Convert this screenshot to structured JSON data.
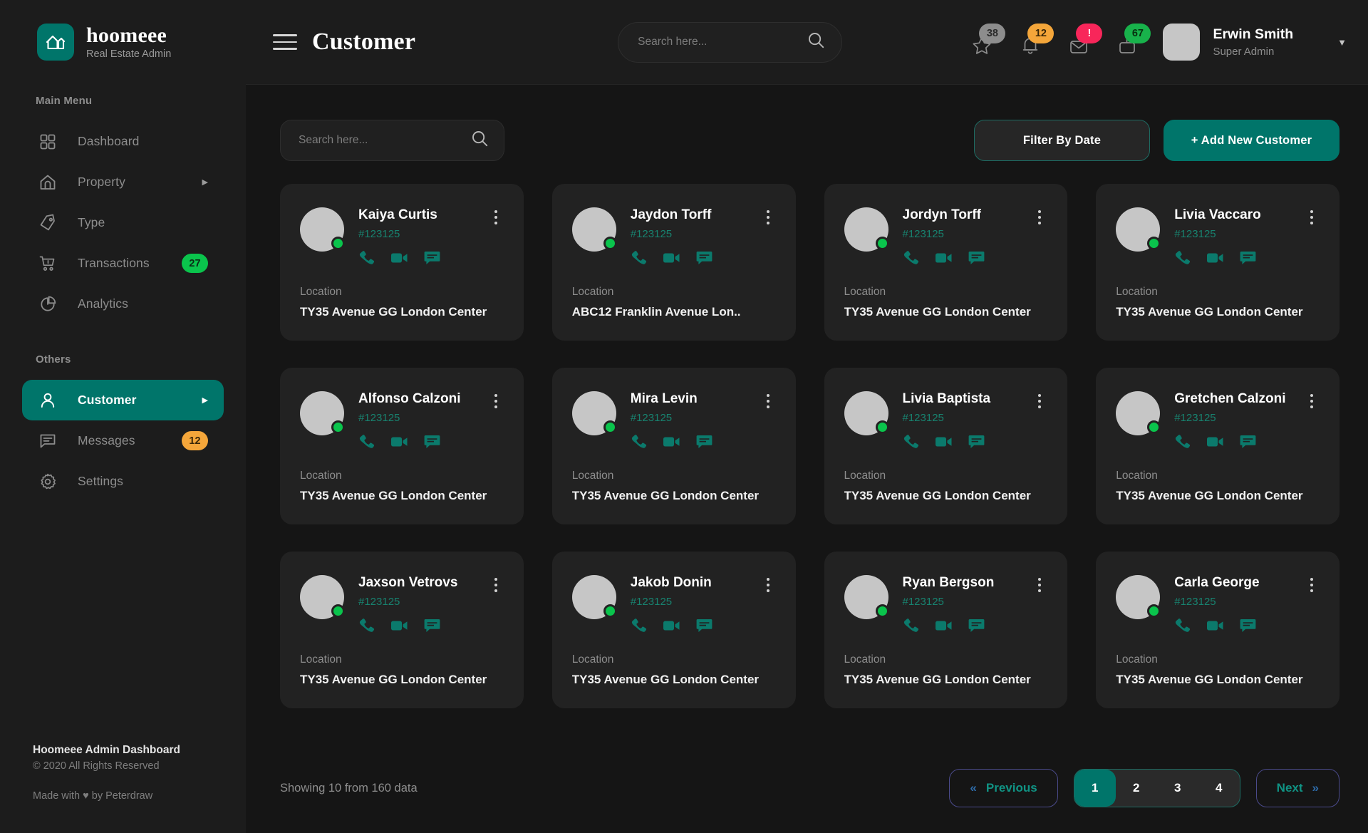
{
  "brand": {
    "name": "hoomeee",
    "subtitle": "Real Estate Admin",
    "logo_icon": "house-icon",
    "logo_color": "#00756a"
  },
  "sidebar": {
    "main_label": "Main Menu",
    "others_label": "Others",
    "main_items": [
      {
        "label": "Dashboard",
        "icon": "grid-icon",
        "badge": null,
        "arrow": false,
        "active": false
      },
      {
        "label": "Property",
        "icon": "home-icon",
        "badge": null,
        "arrow": true,
        "active": false
      },
      {
        "label": "Type",
        "icon": "tag-icon",
        "badge": null,
        "arrow": false,
        "active": false
      },
      {
        "label": "Transactions",
        "icon": "cart-icon",
        "badge": "27",
        "badge_color": "green",
        "arrow": false,
        "active": false
      },
      {
        "label": "Analytics",
        "icon": "pie-chart-icon",
        "badge": null,
        "arrow": false,
        "active": false
      }
    ],
    "other_items": [
      {
        "label": "Customer",
        "icon": "user-icon",
        "badge": null,
        "arrow": true,
        "active": true
      },
      {
        "label": "Messages",
        "icon": "message-icon",
        "badge": "12",
        "badge_color": "orange",
        "arrow": false,
        "active": false
      },
      {
        "label": "Settings",
        "icon": "gear-icon",
        "badge": null,
        "arrow": false,
        "active": false
      }
    ],
    "footer": {
      "title": "Hoomeee Admin Dashboard",
      "copyright": "© 2020 All Rights Reserved",
      "made_by": "Made with ♥ by Peterdraw"
    }
  },
  "topbar": {
    "menu_icon": "hamburger-icon",
    "title": "Customer",
    "search": {
      "placeholder": "Search here...",
      "value": "",
      "icon": "search-icon"
    },
    "icons": [
      {
        "name": "star-icon",
        "badge": "38",
        "badge_color": "#8d8d8d"
      },
      {
        "name": "bell-icon",
        "badge": "12",
        "badge_color": "#f4a63a"
      },
      {
        "name": "mail-icon",
        "badge": "!",
        "badge_color": "#f8265a"
      },
      {
        "name": "archive-icon",
        "badge": "67",
        "badge_color": "#18b24b"
      }
    ],
    "profile": {
      "name": "Erwin Smith",
      "role": "Super Admin",
      "caret_icon": "chevron-down-icon"
    }
  },
  "toolbar": {
    "search": {
      "placeholder": "Search here...",
      "value": "",
      "icon": "search-icon"
    },
    "filter_label": "Filter By Date",
    "add_label": "+ Add New Customer"
  },
  "cards_common": {
    "location_label": "Location",
    "kebab_icon": "more-vertical-icon",
    "actions": [
      "phone-icon",
      "video-icon",
      "chat-icon"
    ]
  },
  "customers": [
    {
      "name": "Kaiya Curtis",
      "id": "#123125",
      "location": "TY35 Avenue GG London Center"
    },
    {
      "name": "Jaydon Torff",
      "id": "#123125",
      "location": "ABC12 Franklin Avenue Lon.."
    },
    {
      "name": "Jordyn Torff",
      "id": "#123125",
      "location": "TY35 Avenue GG London Center"
    },
    {
      "name": "Livia Vaccaro",
      "id": "#123125",
      "location": "TY35 Avenue GG London Center"
    },
    {
      "name": "Alfonso Calzoni",
      "id": "#123125",
      "location": "TY35 Avenue GG London Center"
    },
    {
      "name": "Mira Levin",
      "id": "#123125",
      "location": "TY35 Avenue GG London Center"
    },
    {
      "name": "Livia Baptista",
      "id": "#123125",
      "location": "TY35 Avenue GG London Center"
    },
    {
      "name": "Gretchen Calzoni",
      "id": "#123125",
      "location": "TY35 Avenue GG London Center"
    },
    {
      "name": "Jaxson Vetrovs",
      "id": "#123125",
      "location": "TY35 Avenue GG London Center"
    },
    {
      "name": "Jakob Donin",
      "id": "#123125",
      "location": "TY35 Avenue GG London Center"
    },
    {
      "name": "Ryan Bergson",
      "id": "#123125",
      "location": "TY35 Avenue GG London Center"
    },
    {
      "name": "Carla George",
      "id": "#123125",
      "location": "TY35 Avenue GG London Center"
    }
  ],
  "pagination": {
    "info": "Showing 10 from 160 data",
    "previous_label": "Previous",
    "next_label": "Next",
    "pages": [
      "1",
      "2",
      "3",
      "4"
    ],
    "active_page": "1"
  },
  "colors": {
    "accent": "#00756a",
    "green": "#0ac44c",
    "orange": "#f4a63a",
    "red": "#f8265a",
    "card_bg": "#222222",
    "page_bg": "#151515"
  }
}
